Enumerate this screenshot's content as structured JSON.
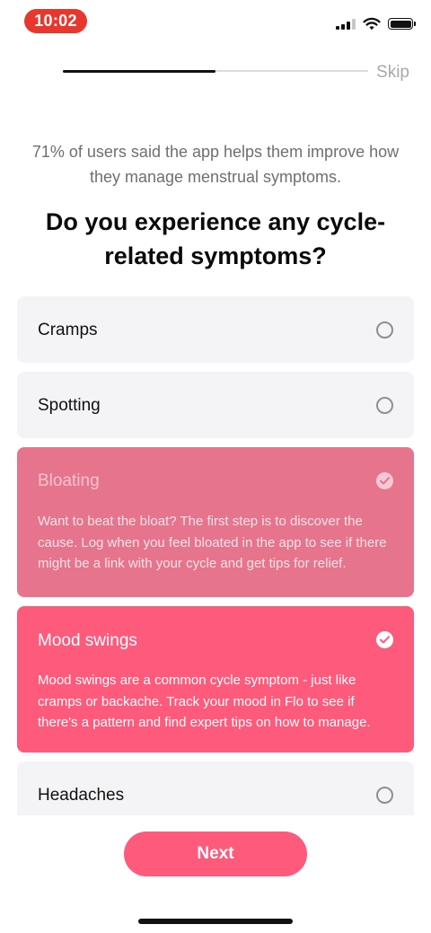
{
  "status_bar": {
    "time": "10:02",
    "icons": [
      "cellular-signal-icon",
      "wifi-icon",
      "battery-icon"
    ]
  },
  "onboarding": {
    "progress": 0.5,
    "skip_label": "Skip"
  },
  "stat_text": "71% of users said the app helps them improve how they manage menstrual symptoms.",
  "question": "Do you experience any cycle-related symptoms?",
  "options": [
    {
      "label": "Cramps",
      "selected": false,
      "description": ""
    },
    {
      "label": "Spotting",
      "selected": false,
      "description": ""
    },
    {
      "label": "Bloating",
      "selected": true,
      "description": "Want to beat the bloat? The first step is to discover the cause. Log when you feel bloated in the app to see if there might be a link with your cycle and get tips for relief."
    },
    {
      "label": "Mood swings",
      "selected": true,
      "description": "Mood swings are a common cycle symptom - just like cramps or backache. Track your mood in Flo to see if there's a pattern and find expert tips on how to manage."
    },
    {
      "label": "Headaches",
      "selected": false,
      "description": ""
    }
  ],
  "next_label": "Next",
  "colors": {
    "accent": "#fd5a7c",
    "accent_faded": "#e5748c",
    "time_pill": "#e8372c",
    "option_bg": "#f4f4f6"
  }
}
